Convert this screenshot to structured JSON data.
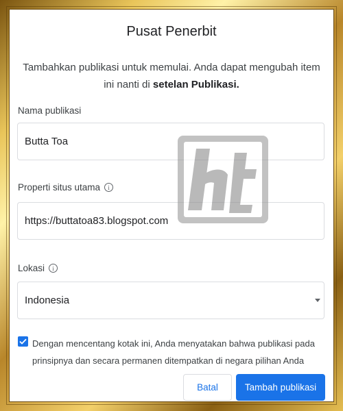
{
  "dialog": {
    "title": "Pusat Penerbit",
    "intro_text": "Tambahkan publikasi untuk memulai. Anda dapat mengubah item ini nanti di ",
    "intro_link": "setelan Publikasi."
  },
  "form": {
    "publication_name": {
      "label": "Nama publikasi",
      "value": "Butta Toa"
    },
    "main_site": {
      "label": "Properti situs utama",
      "value": "https://buttatoa83.blogspot.com",
      "icon": "info-icon"
    },
    "location": {
      "label": "Lokasi",
      "value": "Indonesia",
      "icon": "info-icon"
    },
    "consent": {
      "checked": true,
      "text": "Dengan mencentang kotak ini, Anda menyatakan bahwa publikasi pada prinsipnya dan secara permanen ditempatkan di negara pilihan Anda"
    }
  },
  "actions": {
    "cancel_label": "Batal",
    "add_label": "Tambah publikasi"
  },
  "colors": {
    "accent": "#1a73e8",
    "frame_gold": "#c9a53a"
  }
}
